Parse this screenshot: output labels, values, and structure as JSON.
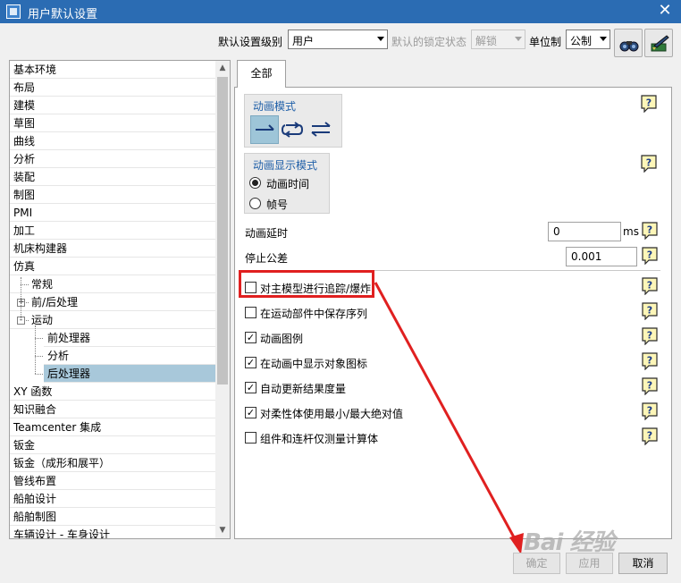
{
  "window": {
    "title": "用户默认设置",
    "close_glyph": "✕"
  },
  "toolbar": {
    "level_label": "默认设置级别",
    "level_value": "用户",
    "lock_state_label": "默认的锁定状态",
    "lock_state_value": "解锁",
    "unit_label": "单位制",
    "unit_value": "公制",
    "tool_icons": [
      "binoculars-icon",
      "edit-settings-icon"
    ]
  },
  "tree": {
    "items": [
      {
        "label": "基本环境",
        "level": 0
      },
      {
        "label": "布局",
        "level": 0
      },
      {
        "label": "建模",
        "level": 0
      },
      {
        "label": "草图",
        "level": 0
      },
      {
        "label": "曲线",
        "level": 0
      },
      {
        "label": "分析",
        "level": 0
      },
      {
        "label": "装配",
        "level": 0
      },
      {
        "label": "制图",
        "level": 0
      },
      {
        "label": "PMI",
        "level": 0
      },
      {
        "label": "加工",
        "level": 0
      },
      {
        "label": "机床构建器",
        "level": 0
      },
      {
        "label": "仿真",
        "level": 0
      },
      {
        "label": "常规",
        "level": 1
      },
      {
        "label": "前/后处理",
        "level": 1,
        "expander": "+"
      },
      {
        "label": "运动",
        "level": 1,
        "expander": "-"
      },
      {
        "label": "前处理器",
        "level": 2
      },
      {
        "label": "分析",
        "level": 2
      },
      {
        "label": "后处理器",
        "level": 2,
        "selected": true
      },
      {
        "label": "XY 函数",
        "level": 0
      },
      {
        "label": "知识融合",
        "level": 0
      },
      {
        "label": "Teamcenter 集成",
        "level": 0
      },
      {
        "label": "钣金",
        "level": 0
      },
      {
        "label": "钣金（成形和展平）",
        "level": 0
      },
      {
        "label": "管线布置",
        "level": 0
      },
      {
        "label": "船舶设计",
        "level": 0
      },
      {
        "label": "船舶制图",
        "level": 0
      },
      {
        "label": "车辆设计 - 车身设计",
        "level": 0
      }
    ],
    "scroll_up": "▲",
    "scroll_down": "▼"
  },
  "main": {
    "tab_label": "全部",
    "animation_mode": {
      "title": "动画模式",
      "buttons": [
        "one-way-arrow-icon",
        "loop-arrows-icon",
        "back-and-forth-arrows-icon"
      ],
      "active_index": 0
    },
    "display_mode": {
      "title": "动画显示模式",
      "options": [
        {
          "label": "动画时间",
          "checked": true
        },
        {
          "label": "帧号",
          "checked": false
        }
      ]
    },
    "delay": {
      "label": "动画延时",
      "value": "0",
      "unit": "ms"
    },
    "tolerance": {
      "label": "停止公差",
      "value": "0.001"
    },
    "checkboxes": [
      {
        "label": "对主模型进行追踪/爆炸",
        "checked": false
      },
      {
        "label": "在运动部件中保存序列",
        "checked": false
      },
      {
        "label": "动画图例",
        "checked": true
      },
      {
        "label": "在动画中显示对象图标",
        "checked": true
      },
      {
        "label": "自动更新结果度量",
        "checked": true
      },
      {
        "label": "对柔性体使用最小/最大绝对值",
        "checked": true
      },
      {
        "label": "组件和连杆仅测量计算体",
        "checked": false
      }
    ],
    "check_glyph": "✓",
    "help_glyph": "?"
  },
  "buttons": {
    "ok": "确定",
    "apply": "应用",
    "cancel": "取消"
  },
  "watermark": "Bai 经验",
  "colors": {
    "titlebar": "#2b6cb3",
    "selection": "#a8c8da",
    "annotation_red": "#e02020",
    "group_title": "#1f5fa8"
  }
}
